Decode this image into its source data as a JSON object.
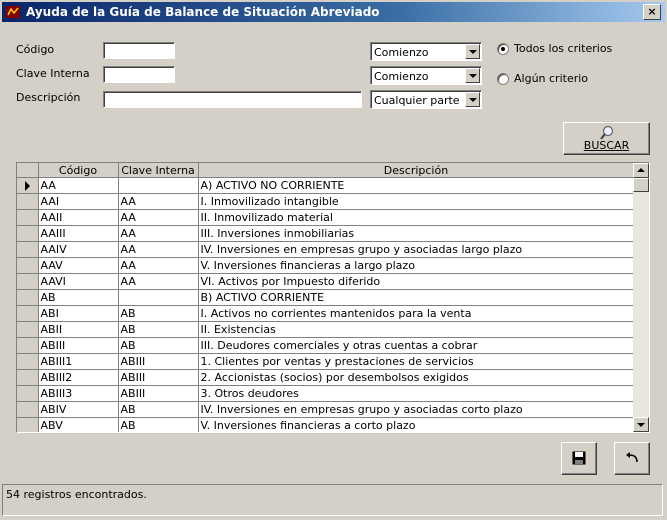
{
  "window": {
    "title": "Ayuda de la Guía de Balance de Situación Abreviado",
    "close_label": "×"
  },
  "form": {
    "codigo_label": "Código",
    "clave_label": "Clave Interna",
    "descripcion_label": "Descripción",
    "codigo_value": "",
    "clave_value": "",
    "descripcion_value": "",
    "codigo_match": "Comienzo",
    "clave_match": "Comienzo",
    "descripcion_match": "Cualquier parte",
    "radio_all": "Todos los criterios",
    "radio_any": "Algún criterio",
    "selected_radio": "Todos los criterios"
  },
  "buscar_label": "BUSCAR",
  "table": {
    "columns": [
      "Código",
      "Clave Interna",
      "Descripción"
    ],
    "rows": [
      {
        "codigo": "AA",
        "clave": "",
        "descripcion": "A) ACTIVO NO CORRIENTE"
      },
      {
        "codigo": "AAI",
        "clave": "AA",
        "descripcion": "I. Inmovilizado intangible"
      },
      {
        "codigo": "AAII",
        "clave": "AA",
        "descripcion": "II. Inmovilizado material"
      },
      {
        "codigo": "AAIII",
        "clave": "AA",
        "descripcion": "III. Inversiones inmobiliarias"
      },
      {
        "codigo": "AAIV",
        "clave": "AA",
        "descripcion": "IV. Inversiones en empresas grupo y asociadas largo plazo"
      },
      {
        "codigo": "AAV",
        "clave": "AA",
        "descripcion": "V. Inversiones financieras a largo plazo"
      },
      {
        "codigo": "AAVI",
        "clave": "AA",
        "descripcion": "VI. Activos por Impuesto diferido"
      },
      {
        "codigo": "AB",
        "clave": "",
        "descripcion": "B) ACTIVO CORRIENTE"
      },
      {
        "codigo": "ABI",
        "clave": "AB",
        "descripcion": "I. Activos no corrientes mantenidos para la venta"
      },
      {
        "codigo": "ABII",
        "clave": "AB",
        "descripcion": "II. Existencias"
      },
      {
        "codigo": "ABIII",
        "clave": "AB",
        "descripcion": "III. Deudores comerciales y otras cuentas a cobrar"
      },
      {
        "codigo": "ABIII1",
        "clave": "ABIII",
        "descripcion": "1. Clientes por ventas y prestaciones de servicios"
      },
      {
        "codigo": "ABIII2",
        "clave": "ABIII",
        "descripcion": "2. Accionistas (socios) por desembolsos exigidos"
      },
      {
        "codigo": "ABIII3",
        "clave": "ABIII",
        "descripcion": "3. Otros deudores"
      },
      {
        "codigo": "ABIV",
        "clave": "AB",
        "descripcion": "IV. Inversiones en empresas grupo y asociadas corto plazo"
      },
      {
        "codigo": "ABV",
        "clave": "AB",
        "descripcion": "V. Inversiones financieras a corto plazo"
      }
    ]
  },
  "status": "54 registros encontrados."
}
